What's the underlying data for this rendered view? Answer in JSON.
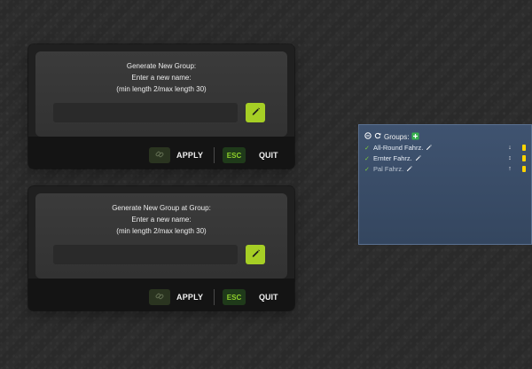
{
  "colors": {
    "accent_green": "#a6cf25",
    "yellow": "#ffd400",
    "panel_blue": "#3f5370"
  },
  "dialogs": [
    {
      "title": "Generate New Group:",
      "prompt": "Enter a new name:",
      "constraints": "(min length 2/max length 30)",
      "input_value": "",
      "apply_label": "APPLY",
      "esc_label": "ESC",
      "quit_label": "QUIT",
      "icons": {
        "edit": "pencil-icon",
        "link": "link-icon"
      }
    },
    {
      "title": "Generate New Group at Group:",
      "prompt": "Enter a new name:",
      "constraints": "(min length 2/max length 30)",
      "input_value": "",
      "apply_label": "APPLY",
      "esc_label": "ESC",
      "quit_label": "QUIT",
      "icons": {
        "edit": "pencil-icon",
        "link": "link-icon"
      }
    }
  ],
  "groups_panel": {
    "header": "Groups:",
    "icons": {
      "collapse": "minus-icon",
      "refresh": "refresh-icon",
      "add": "add-green-icon"
    },
    "rows": [
      {
        "label": "All-Round Fahrz.",
        "muted": false,
        "arrow": "↓"
      },
      {
        "label": "Ernter Fahrz.",
        "muted": false,
        "arrow": "↕"
      },
      {
        "label": "Pal Fahrz.",
        "muted": true,
        "arrow": "↑"
      }
    ]
  }
}
